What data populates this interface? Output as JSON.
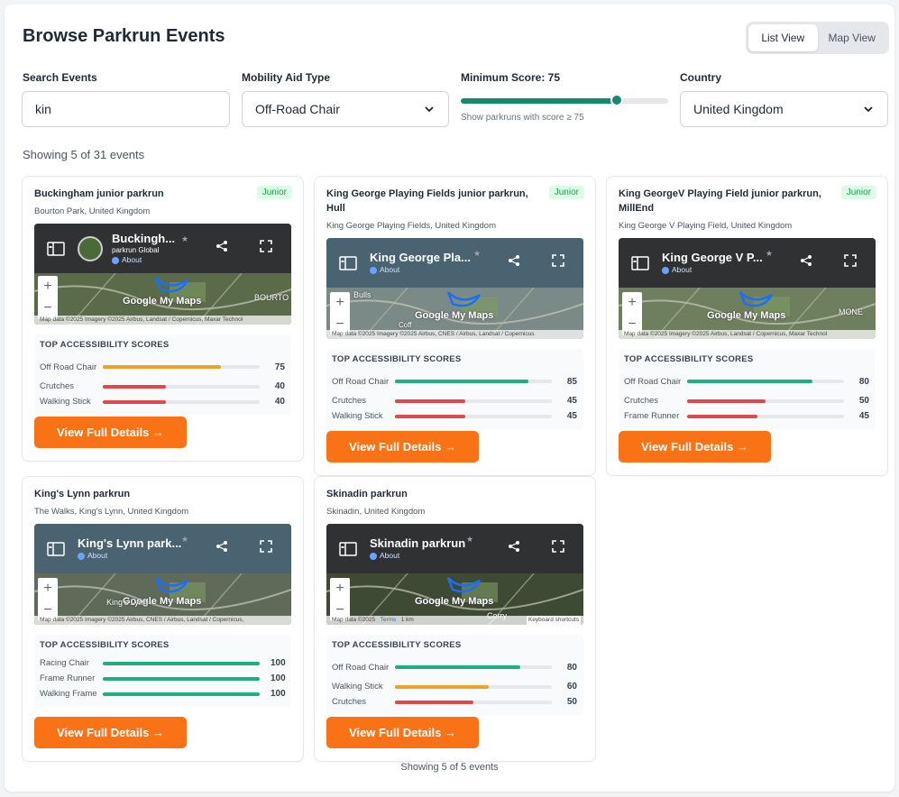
{
  "header": {
    "title": "Browse Parkrun Events",
    "toggle": {
      "list": "List View",
      "map": "Map View",
      "active": "list"
    }
  },
  "filters": {
    "search": {
      "label": "Search Events",
      "value": "kin"
    },
    "mobility": {
      "label": "Mobility Aid Type",
      "value": "Off-Road Chair"
    },
    "score": {
      "label": "Minimum Score: 75",
      "value": 75,
      "max": 100,
      "hint": "Show parkruns with score ≥ 75"
    },
    "country": {
      "label": "Country",
      "value": "United Kingdom"
    }
  },
  "results": {
    "showing": "Showing 5 of 31 events",
    "footer": "Showing 5 of 5 events"
  },
  "button_label": "View Full Details →",
  "scores_title": "TOP ACCESSIBILITY SCORES",
  "colors": {
    "green": "#1fae7f",
    "orange": "#eea226",
    "red": "#dc4a4a",
    "accent": "#f97316"
  },
  "cards": [
    {
      "name": "Buckingham junior parkrun",
      "badge": "Junior",
      "location": "Bourton Park, United Kingdom",
      "map": {
        "title": "Buckingh...",
        "subtitle": "parkrun Global",
        "about": "About",
        "attribution": "Map data ©2025 Imagery ©2025 Airbus, Landsat / Copernicus, Maxar Technol",
        "label": "BOURTO",
        "extra": ""
      },
      "scores": [
        {
          "name": "Off Road Chair",
          "value": 75,
          "color": "#eea226"
        },
        {
          "name": "Crutches",
          "value": 40,
          "color": "#dc4a4a"
        },
        {
          "name": "Walking Stick",
          "value": 40,
          "color": "#dc4a4a"
        }
      ]
    },
    {
      "name": "King George Playing Fields junior parkrun, Hull",
      "badge": "Junior",
      "location": "King George Playing Fields, United Kingdom",
      "map": {
        "title": "King George Pla...",
        "subtitle": "",
        "about": "About",
        "attribution": "Map data ©2025 Imagery ©2025 Airbus, CNES / Airbus, Landsat / Copernicus",
        "label": "Bulls",
        "extra": "Coff"
      },
      "scores": [
        {
          "name": "Off Road Chair",
          "value": 85,
          "color": "#1fae7f"
        },
        {
          "name": "Crutches",
          "value": 45,
          "color": "#dc4a4a"
        },
        {
          "name": "Walking Stick",
          "value": 45,
          "color": "#dc4a4a"
        }
      ]
    },
    {
      "name": "King GeorgeV Playing Field junior parkrun, MillEnd",
      "badge": "Junior",
      "location": "King George V Playing Field, United Kingdom",
      "map": {
        "title": "King George V P...",
        "subtitle": "",
        "about": "About",
        "attribution": "Map data ©2025 Imagery ©2025 Airbus, Landsat / Copernicus, Maxar Technol",
        "label": "MONE",
        "extra": ""
      },
      "scores": [
        {
          "name": "Off Road Chair",
          "value": 80,
          "color": "#1fae7f"
        },
        {
          "name": "Crutches",
          "value": 50,
          "color": "#dc4a4a"
        },
        {
          "name": "Frame Runner",
          "value": 45,
          "color": "#dc4a4a"
        }
      ]
    },
    {
      "name": "King's Lynn parkrun",
      "badge": "",
      "location": "The Walks, King's Lynn, United Kingdom",
      "map": {
        "title": "King's Lynn park...",
        "subtitle": "",
        "about": "About",
        "attribution": "Map data ©2025 Imagery ©2025 Airbus, CNES / Airbus, Landsat / Copernicus,",
        "label": "King's Lynn",
        "extra": ""
      },
      "scores": [
        {
          "name": "Racing Chair",
          "value": 100,
          "color": "#1fae7f"
        },
        {
          "name": "Frame Runner",
          "value": 100,
          "color": "#1fae7f"
        },
        {
          "name": "Walking Frame",
          "value": 100,
          "color": "#1fae7f"
        }
      ]
    },
    {
      "name": "Skinadin parkrun",
      "badge": "",
      "location": "Skinadin, United Kingdom",
      "map": {
        "title": "Skinadin parkrun",
        "subtitle": "",
        "about": "About",
        "attribution": "Map data ©2025",
        "label": "Corry",
        "extra": "Keyboard shortcuts",
        "terms": "Terms",
        "scale": "1 km"
      },
      "scores": [
        {
          "name": "Off Road Chair",
          "value": 80,
          "color": "#1fae7f"
        },
        {
          "name": "Walking Stick",
          "value": 60,
          "color": "#eea226"
        },
        {
          "name": "Crutches",
          "value": 50,
          "color": "#dc4a4a"
        }
      ]
    }
  ]
}
